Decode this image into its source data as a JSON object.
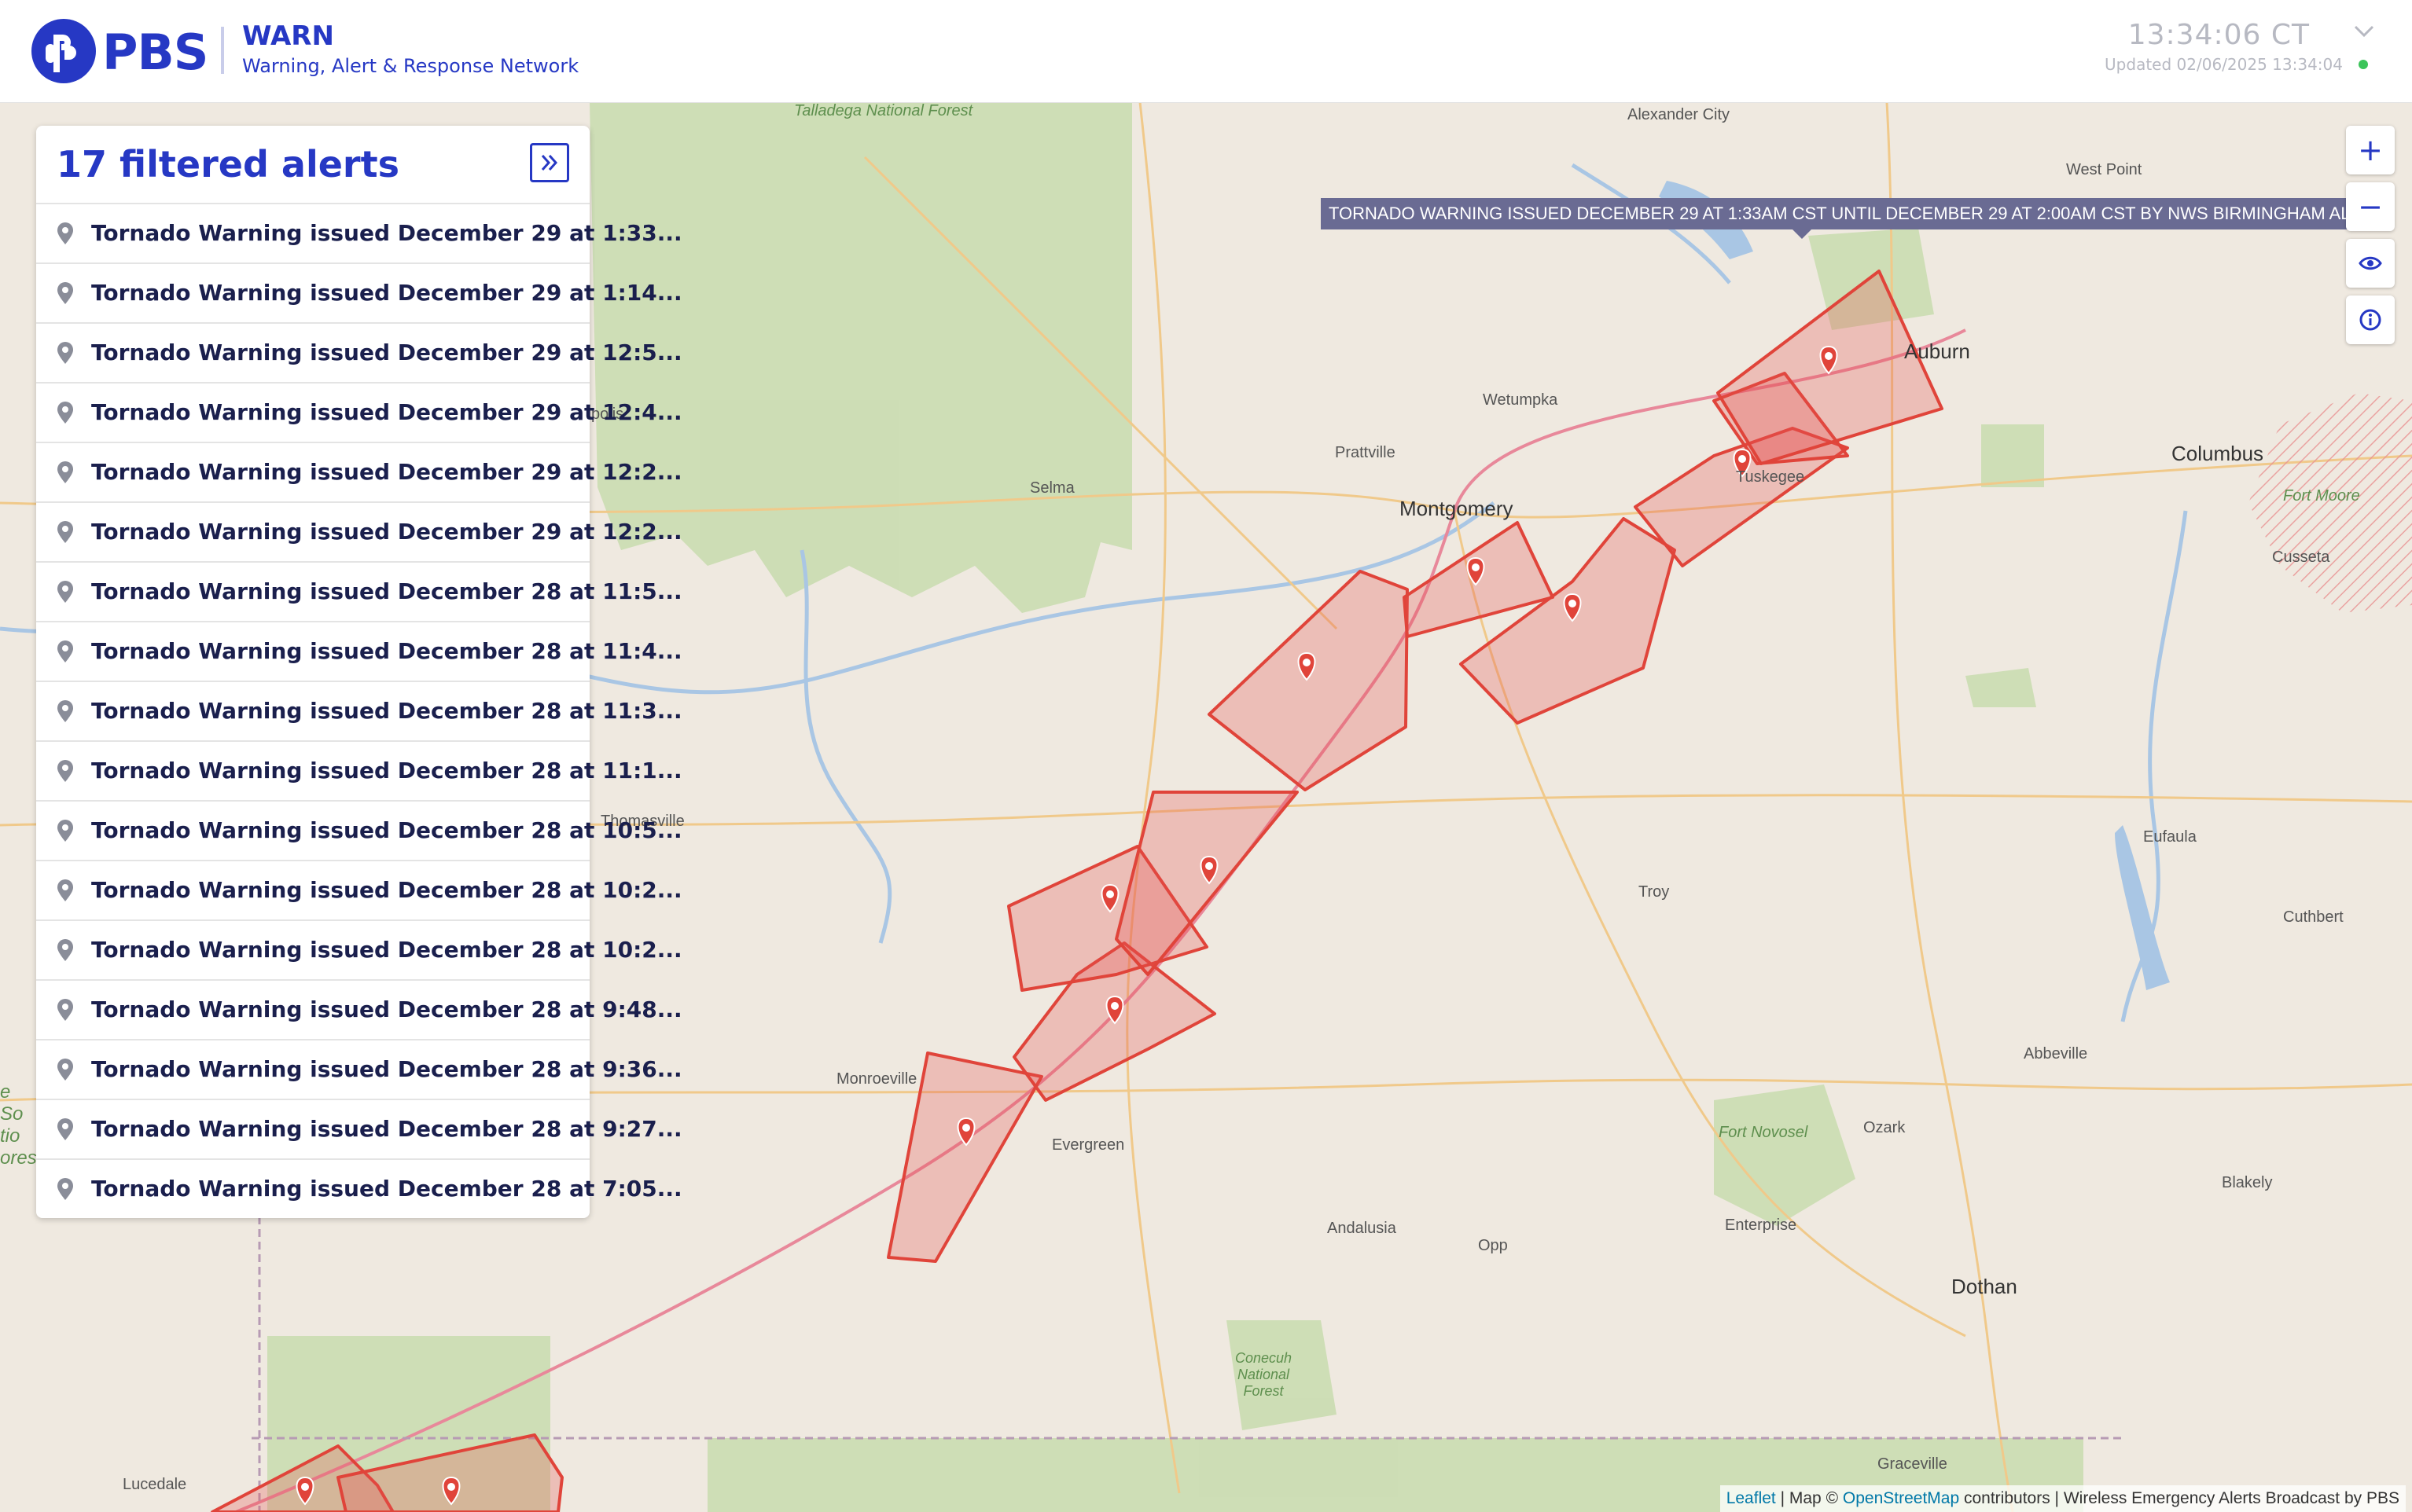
{
  "header": {
    "logo_text": "PBS",
    "app_title": "WARN",
    "app_subtitle": "Warning, Alert & Response Network",
    "clock": "13:34:06 CT",
    "updated": "Updated 02/06/2025 13:34:04",
    "status_color": "#3cc45a"
  },
  "panel": {
    "title": "17 filtered alerts",
    "collapse_icon": "double-chevron-right-icon",
    "alerts": [
      {
        "label": "Tornado Warning issued December 29 at 1:33..."
      },
      {
        "label": "Tornado Warning issued December 29 at 1:14..."
      },
      {
        "label": "Tornado Warning issued December 29 at 12:5..."
      },
      {
        "label": "Tornado Warning issued December 29 at 12:4..."
      },
      {
        "label": "Tornado Warning issued December 29 at 12:2..."
      },
      {
        "label": "Tornado Warning issued December 29 at 12:2..."
      },
      {
        "label": "Tornado Warning issued December 28 at 11:5..."
      },
      {
        "label": "Tornado Warning issued December 28 at 11:4..."
      },
      {
        "label": "Tornado Warning issued December 28 at 11:3..."
      },
      {
        "label": "Tornado Warning issued December 28 at 11:1..."
      },
      {
        "label": "Tornado Warning issued December 28 at 10:5..."
      },
      {
        "label": "Tornado Warning issued December 28 at 10:2..."
      },
      {
        "label": "Tornado Warning issued December 28 at 10:2..."
      },
      {
        "label": "Tornado Warning issued December 28 at 9:48..."
      },
      {
        "label": "Tornado Warning issued December 28 at 9:36..."
      },
      {
        "label": "Tornado Warning issued December 28 at 9:27..."
      },
      {
        "label": "Tornado Warning issued December 28 at 7:05..."
      }
    ]
  },
  "map": {
    "tooltip": "TORNADO WARNING ISSUED DECEMBER 29 AT 1:33AM CST UNTIL DECEMBER 29 AT 2:00AM CST BY NWS BIRMINGHAM AL",
    "controls": {
      "zoom_in": "+",
      "zoom_out": "−",
      "visibility_icon": "eye-icon",
      "info_icon": "info-icon"
    },
    "warning_color": "#e0443a",
    "places": {
      "talladega": "Talladega National Forest",
      "alexander_city": "Alexander City",
      "west_point": "West Point",
      "auburn": "Auburn",
      "wetumpka": "Wetumpka",
      "prattville": "Prattville",
      "montgomery": "Montgomery",
      "selma": "Selma",
      "tuskegee": "Tuskegee",
      "columbus": "Columbus",
      "fort_moore": "Fort Moore",
      "cusseta": "Cusseta",
      "polis": "polis",
      "thomasville": "Thomasville",
      "eufaula": "Eufaula",
      "troy": "Troy",
      "cuthbert": "Cuthbert",
      "abbeville": "Abbeville",
      "monroeville": "Monroeville",
      "evergreen": "Evergreen",
      "fort_novosel": "Fort Novosel",
      "ozark": "Ozark",
      "blakely": "Blakely",
      "enterprise": "Enterprise",
      "andalusia": "Andalusia",
      "opp": "Opp",
      "dothan": "Dothan",
      "conecuh": "Conecuh National Forest",
      "graceville": "Graceville",
      "lucedale": "Lucedale",
      "edge_text": "e So tio ores"
    },
    "attribution": {
      "leaflet": "Leaflet",
      "sep1": " | Map © ",
      "osm": "OpenStreetMap",
      "rest": " contributors | Wireless Emergency Alerts Broadcast by PBS"
    }
  }
}
